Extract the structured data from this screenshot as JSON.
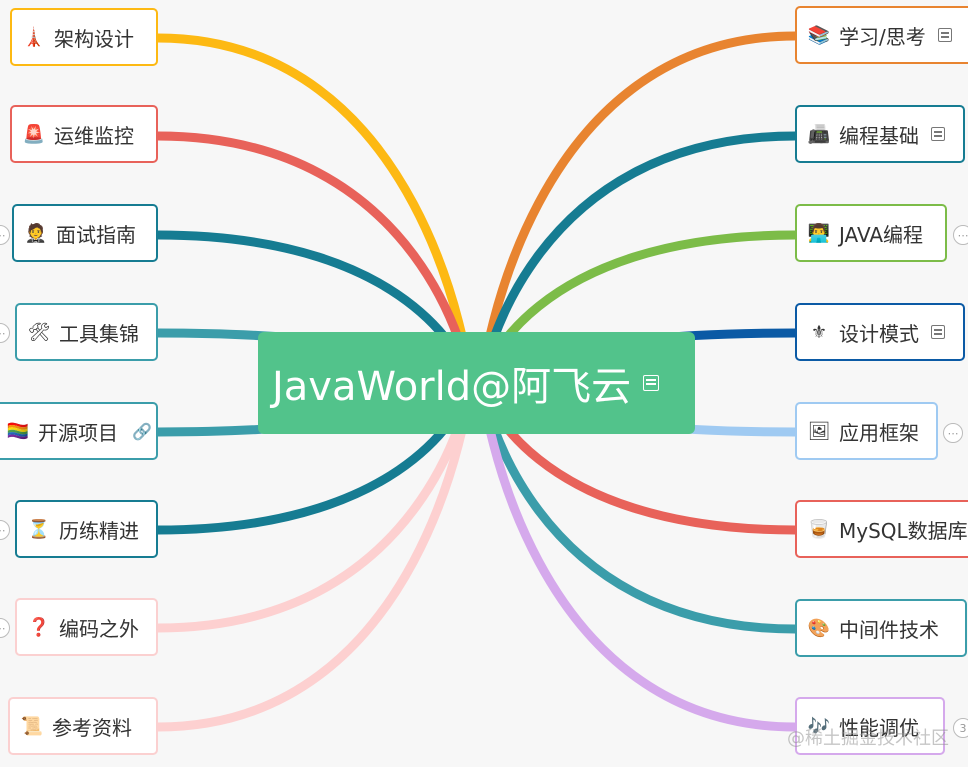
{
  "root": {
    "title": "JavaWorld@阿飞云"
  },
  "left_nodes": [
    {
      "label": "架构设计",
      "icon": "rocket-icon",
      "glyph": "🗼",
      "color": "#fdb913"
    },
    {
      "label": "运维监控",
      "icon": "siren-icon",
      "glyph": "🚨",
      "color": "#e8625a"
    },
    {
      "label": "面试指南",
      "icon": "person-icon",
      "glyph": "🤵",
      "color": "#167c92"
    },
    {
      "label": "工具集锦",
      "icon": "tools-icon",
      "glyph": "🛠",
      "color": "#3b9daa"
    },
    {
      "label": "开源项目",
      "icon": "rainbow-flag-icon",
      "glyph": "🏳️‍🌈",
      "color": "#3b9daa"
    },
    {
      "label": "历练精进",
      "icon": "hourglass-icon",
      "glyph": "⏳",
      "color": "#167c92"
    },
    {
      "label": "编码之外",
      "icon": "question-icon",
      "glyph": "❓",
      "color": "#fdd0d0"
    },
    {
      "label": "参考资料",
      "icon": "scroll-icon",
      "glyph": "📜",
      "color": "#fdd0d0"
    }
  ],
  "right_nodes": [
    {
      "label": "学习/思考",
      "icon": "books-icon",
      "glyph": "📚",
      "color": "#e88430"
    },
    {
      "label": "编程基础",
      "icon": "typewriter-icon",
      "glyph": "📠",
      "color": "#167c92"
    },
    {
      "label": "JAVA编程",
      "icon": "technologist-icon",
      "glyph": "👨‍💻",
      "color": "#7cbc48"
    },
    {
      "label": "设计模式",
      "icon": "fleur-de-lis-icon",
      "glyph": "⚜",
      "color": "#0b5aa5"
    },
    {
      "label": "应用框架",
      "icon": "frame-icon",
      "glyph": "🖼",
      "color": "#9fcaf2"
    },
    {
      "label": "MySQL数据库",
      "icon": "beer-mug-icon",
      "glyph": "🥃",
      "color": "#e8625a"
    },
    {
      "label": "中间件技术",
      "icon": "palette-icon",
      "glyph": "🎨",
      "color": "#3b9daa"
    },
    {
      "label": "性能调优",
      "icon": "dna-icon",
      "glyph": "🎶",
      "color": "#d5a9ec"
    }
  ],
  "collapsed_count": "3",
  "watermark": "@稀土掘金技术社区"
}
